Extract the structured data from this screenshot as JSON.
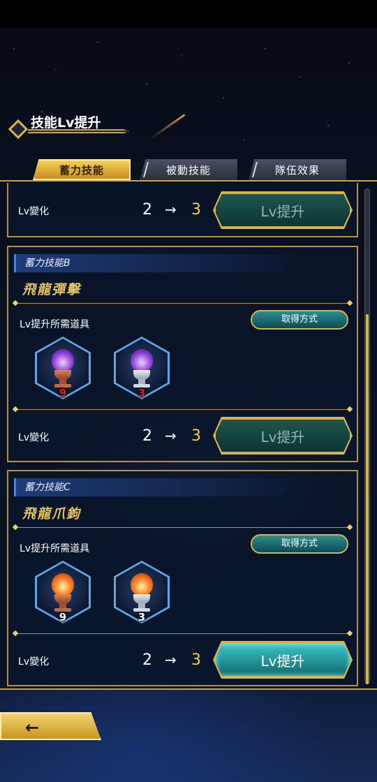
{
  "header": {
    "title": "技能Lv提升"
  },
  "tabs": [
    {
      "label": "蓄力技能",
      "active": true
    },
    {
      "label": "被動技能",
      "active": false
    },
    {
      "label": "隊伍效果",
      "active": false
    }
  ],
  "top_row": {
    "label": "Lv變化",
    "from": "2",
    "arrow": "→",
    "to": "3",
    "button": "Lv提升"
  },
  "cards": [
    {
      "category": "蓄力技能B",
      "name": "飛龍彈擊",
      "need_label": "Lv提升所需道具",
      "acquire_label": "取得方式",
      "items": [
        {
          "icon": "purple-flame-copper-brazier-icon",
          "count": "9",
          "count_color": "#e02020"
        },
        {
          "icon": "purple-flame-silver-brazier-icon",
          "count": "3",
          "count_color": "#e02020"
        }
      ],
      "lv": {
        "label": "Lv變化",
        "from": "2",
        "arrow": "→",
        "to": "3",
        "button": "Lv提升",
        "enabled": false
      }
    },
    {
      "category": "蓄力技能C",
      "name": "飛龍爪鉤",
      "need_label": "Lv提升所需道具",
      "acquire_label": "取得方式",
      "items": [
        {
          "icon": "red-flame-copper-brazier-icon",
          "count": "9",
          "count_color": "#ffffff"
        },
        {
          "icon": "red-flame-silver-brazier-icon",
          "count": "3",
          "count_color": "#ffffff"
        }
      ],
      "lv": {
        "label": "Lv變化",
        "from": "2",
        "arrow": "→",
        "to": "3",
        "button": "Lv提升",
        "enabled": true
      }
    }
  ],
  "back": {
    "label": "←",
    "icon": "back-arrow-icon"
  },
  "colors": {
    "gold": "#d9b24a",
    "teal": "#2a8f90",
    "level_to": "#f2d040"
  }
}
